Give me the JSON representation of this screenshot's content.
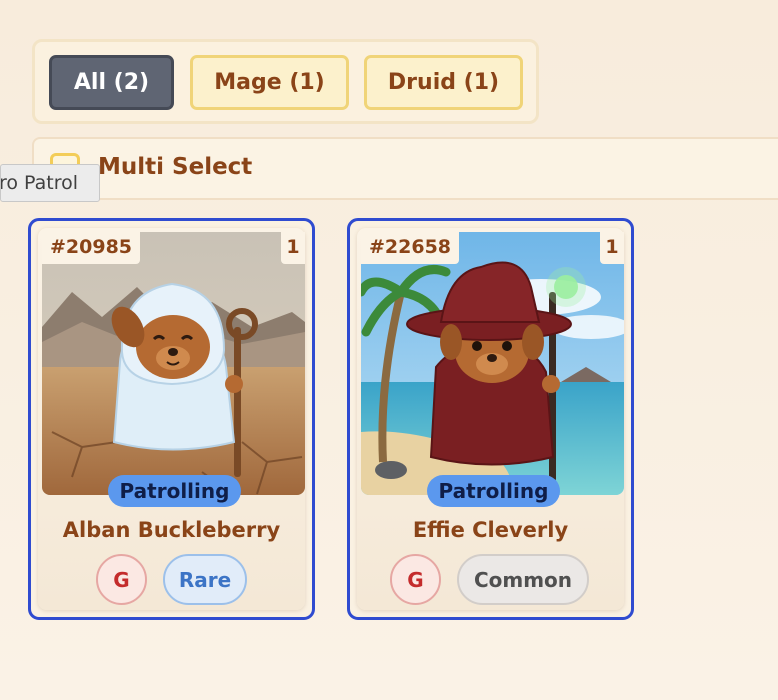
{
  "filters": {
    "items": [
      {
        "label": "All (2)",
        "active": true
      },
      {
        "label": "Mage (1)",
        "active": false
      },
      {
        "label": "Druid (1)",
        "active": false
      }
    ]
  },
  "multi_select": {
    "label": "Multi Select"
  },
  "tooltip": {
    "text": "ro Patrol"
  },
  "cards": [
    {
      "id": "#20985",
      "count": "1",
      "status": "Patrolling",
      "name": "Alban Buckleberry",
      "gen": "G",
      "rarity": "Rare",
      "scene": "desert"
    },
    {
      "id": "#22658",
      "count": "1",
      "status": "Patrolling",
      "name": "Effie Cleverly",
      "gen": "G",
      "rarity": "Common",
      "scene": "beach"
    }
  ],
  "colors": {
    "selected_border": "#2f4bd0",
    "status_pill": "#5b98ee",
    "accent_text": "#8a4418"
  }
}
